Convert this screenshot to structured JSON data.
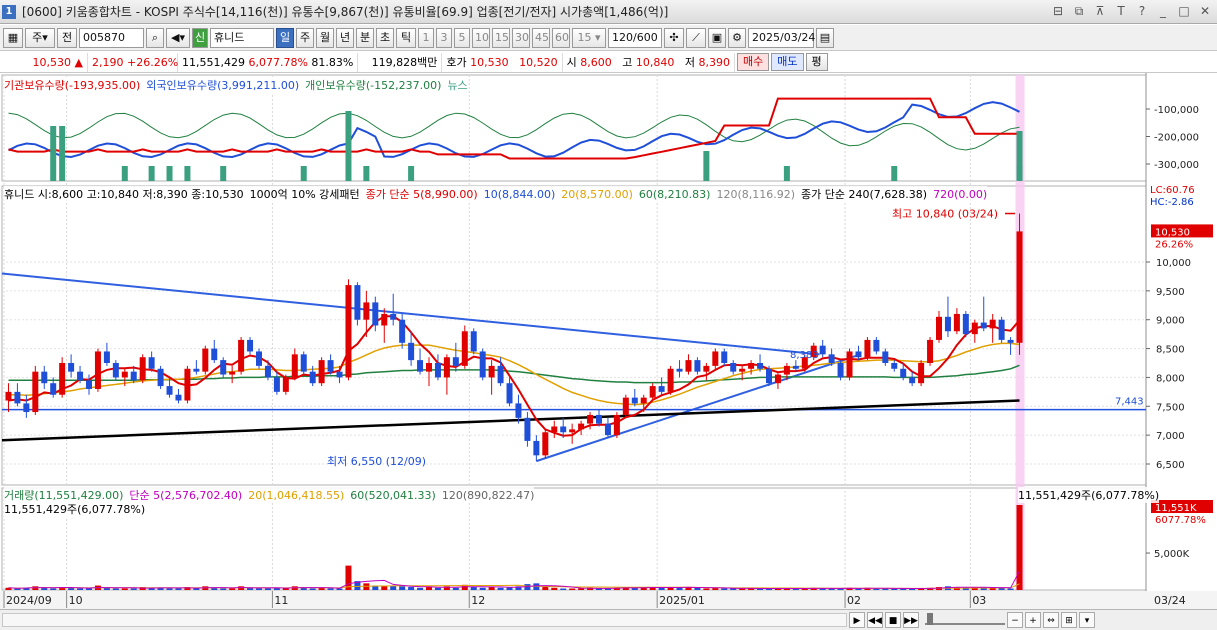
{
  "window": {
    "number": "1",
    "title": "[0600] 키움종합차트 - KOSPI 주식수[14,116(천)] 유통수[9,867(천)] 유통비율[69.9] 업종[전기/전자] 시가총액[1,486(억)]"
  },
  "toolbar": {
    "period_unit": "주",
    "prev_label": "전",
    "code": "005870",
    "stock_name": "휴니드",
    "stock_badge": "신",
    "periods": [
      "일",
      "주",
      "월",
      "년",
      "분",
      "초",
      "틱"
    ],
    "minutes": [
      "1",
      "3",
      "5",
      "10",
      "15",
      "30",
      "45",
      "60"
    ],
    "custom_min": "15",
    "count": "120",
    "count_max": "/600",
    "date": "2025/03/24"
  },
  "pricebar": {
    "price": "10,530",
    "arrow": "▲",
    "change": "2,190",
    "change_pct": "+26.26%",
    "volume": "11,551,429",
    "vol_ratio": "6,077.78%",
    "turnover": "81.83%",
    "amount": "119,828백만",
    "ask_label": "호가",
    "ask": "10,530",
    "bid": "10,520",
    "open_label": "시",
    "open": "8,600",
    "high_label": "고",
    "high": "10,840",
    "low_label": "저",
    "low": "8,390",
    "buy_label": "매수",
    "sell_label": "매도",
    "flat_label": "평"
  },
  "investor_panel": {
    "legend": [
      {
        "text": "기관보유수량(-193,935.00)",
        "color": "#e00000"
      },
      {
        "text": "외국인보유수량(3,991,211.00)",
        "color": "#1f4fd8"
      },
      {
        "text": "개인보유수량(-152,237.00)",
        "color": "#208040"
      },
      {
        "text": "뉴스",
        "color": "#3aa080"
      }
    ],
    "axis": [
      "-100,000",
      "-200,000",
      "-300,000"
    ]
  },
  "price_panel": {
    "legend_name": "휴니드 시:8,600 고:10,840 저:8,390 종:10,530",
    "legend_pattern": "1000억 10% 강세패턴",
    "ma_legend": [
      {
        "text": "종가 단순 5(8,990.00)",
        "color": "#e00000"
      },
      {
        "text": "10(8,844.00)",
        "color": "#1f4fd8"
      },
      {
        "text": "20(8,570.00)",
        "color": "#e0a000"
      },
      {
        "text": "60(8,210.83)",
        "color": "#208040"
      },
      {
        "text": "120(8,116.92)",
        "color": "#888888"
      },
      {
        "text": "종가 단순 240(7,628.38)",
        "color": "#000000"
      },
      {
        "text": "720(0.00)",
        "color": "#c000c0"
      }
    ],
    "lc": "LC:60.76",
    "hc": "HC:-2.86",
    "high_mark": "최고 10,840 (03/24)",
    "low_mark": "최저 6,550 (12/09)",
    "hline_label": "7,443",
    "trend_label": "8,388",
    "current_price": "10,530",
    "current_pct": "26.26%",
    "axis": [
      "10,000",
      "9,500",
      "9,000",
      "8,500",
      "8,000",
      "7,500",
      "7,000",
      "6,500"
    ]
  },
  "volume_panel": {
    "legend": [
      {
        "text": "거래량(11,551,429.00)",
        "color": "#208040"
      },
      {
        "text": "단순 5(2,576,702.40)",
        "color": "#c000c0"
      },
      {
        "text": "20(1,046,418.55)",
        "color": "#e0a000"
      },
      {
        "text": "60(520,041.33)",
        "color": "#208040"
      },
      {
        "text": "120(890,822.47)",
        "color": "#666666"
      }
    ],
    "sub_legend": "11,551,429주(6,077.78%)",
    "top_right": "11,551,429주(6,077.78%)",
    "current": "11,551K",
    "current_pct": "6077.78%",
    "axis": [
      "5,000K"
    ]
  },
  "xaxis": [
    "2024/09",
    "10",
    "11",
    "12",
    "2025/01",
    "02",
    "03"
  ],
  "last_date": "03/24",
  "colors": {
    "up": "#e00000",
    "down": "#1f4fd8",
    "highlight": "#f8c8f0"
  },
  "chart_data": {
    "type": "candlestick",
    "ylim": [
      6200,
      11000
    ],
    "candles": [
      [
        7600,
        7900,
        7400,
        7750
      ],
      [
        7750,
        7900,
        7500,
        7550
      ],
      [
        7550,
        7700,
        7300,
        7400
      ],
      [
        7400,
        8200,
        7350,
        8100
      ],
      [
        8100,
        8200,
        7800,
        7900
      ],
      [
        7900,
        8000,
        7650,
        7700
      ],
      [
        7700,
        8350,
        7650,
        8250
      ],
      [
        8250,
        8400,
        8000,
        8100
      ],
      [
        8100,
        8200,
        7900,
        7950
      ],
      [
        7950,
        8050,
        7700,
        7800
      ],
      [
        7800,
        8500,
        7750,
        8450
      ],
      [
        8450,
        8600,
        8200,
        8250
      ],
      [
        8250,
        8300,
        7950,
        8000
      ],
      [
        8000,
        8150,
        7850,
        8100
      ],
      [
        8100,
        8200,
        7900,
        7950
      ],
      [
        7950,
        8400,
        7900,
        8350
      ],
      [
        8350,
        8450,
        8100,
        8150
      ],
      [
        8150,
        8200,
        7800,
        7850
      ],
      [
        7850,
        8000,
        7650,
        7700
      ],
      [
        7700,
        7800,
        7550,
        7600
      ],
      [
        7600,
        8200,
        7550,
        8150
      ],
      [
        8150,
        8300,
        8050,
        8100
      ],
      [
        8100,
        8550,
        8050,
        8500
      ],
      [
        8500,
        8650,
        8250,
        8300
      ],
      [
        8300,
        8350,
        8000,
        8050
      ],
      [
        8050,
        8200,
        7900,
        8100
      ],
      [
        8100,
        8700,
        8050,
        8650
      ],
      [
        8650,
        8700,
        8400,
        8450
      ],
      [
        8450,
        8500,
        8150,
        8200
      ],
      [
        8200,
        8300,
        7950,
        8000
      ],
      [
        8000,
        8100,
        7700,
        7750
      ],
      [
        7750,
        8050,
        7700,
        8000
      ],
      [
        8000,
        8500,
        7950,
        8400
      ],
      [
        8400,
        8450,
        8050,
        8100
      ],
      [
        8100,
        8200,
        7850,
        7900
      ],
      [
        7900,
        8350,
        7850,
        8300
      ],
      [
        8300,
        8400,
        8050,
        8100
      ],
      [
        8100,
        8200,
        7900,
        8000
      ],
      [
        8000,
        9700,
        7950,
        9600
      ],
      [
        9600,
        9650,
        8900,
        9000
      ],
      [
        9000,
        9500,
        8700,
        9300
      ],
      [
        9300,
        9400,
        8800,
        8900
      ],
      [
        8900,
        9200,
        8600,
        9100
      ],
      [
        9100,
        9450,
        8900,
        9000
      ],
      [
        9000,
        9100,
        8500,
        8600
      ],
      [
        8600,
        8800,
        8200,
        8300
      ],
      [
        8300,
        8500,
        8050,
        8100
      ],
      [
        8100,
        8350,
        7850,
        8250
      ],
      [
        8250,
        8400,
        7950,
        8000
      ],
      [
        8000,
        8400,
        7700,
        8350
      ],
      [
        8350,
        8600,
        8100,
        8200
      ],
      [
        8200,
        8900,
        8150,
        8800
      ],
      [
        8800,
        8850,
        8400,
        8450
      ],
      [
        8450,
        8500,
        7950,
        8000
      ],
      [
        8000,
        8300,
        7700,
        8200
      ],
      [
        8200,
        8350,
        7850,
        7900
      ],
      [
        7900,
        8000,
        7500,
        7550
      ],
      [
        7550,
        7700,
        7200,
        7300
      ],
      [
        7300,
        7400,
        6800,
        6900
      ],
      [
        6900,
        7000,
        6550,
        6650
      ],
      [
        6650,
        7100,
        6600,
        7050
      ],
      [
        7050,
        7250,
        6950,
        7150
      ],
      [
        7150,
        7300,
        6950,
        7050
      ],
      [
        7050,
        7200,
        6850,
        7100
      ],
      [
        7100,
        7250,
        7000,
        7200
      ],
      [
        7200,
        7400,
        7100,
        7350
      ],
      [
        7350,
        7450,
        7150,
        7200
      ],
      [
        7200,
        7300,
        6950,
        7000
      ],
      [
        7000,
        7400,
        6950,
        7350
      ],
      [
        7350,
        7700,
        7300,
        7650
      ],
      [
        7650,
        7800,
        7500,
        7550
      ],
      [
        7550,
        7700,
        7400,
        7650
      ],
      [
        7650,
        7900,
        7600,
        7850
      ],
      [
        7850,
        8000,
        7700,
        7750
      ],
      [
        7750,
        8200,
        7700,
        8150
      ],
      [
        8150,
        8300,
        8000,
        8100
      ],
      [
        8100,
        8400,
        8050,
        8300
      ],
      [
        8300,
        8350,
        8050,
        8100
      ],
      [
        8100,
        8250,
        7950,
        8200
      ],
      [
        8200,
        8500,
        8150,
        8450
      ],
      [
        8450,
        8500,
        8200,
        8250
      ],
      [
        8250,
        8300,
        8050,
        8100
      ],
      [
        8100,
        8200,
        7950,
        8150
      ],
      [
        8150,
        8300,
        8050,
        8250
      ],
      [
        8250,
        8400,
        8100,
        8150
      ],
      [
        8150,
        8200,
        7850,
        7900
      ],
      [
        7900,
        8100,
        7800,
        8050
      ],
      [
        8050,
        8250,
        7950,
        8200
      ],
      [
        8200,
        8300,
        8100,
        8150
      ],
      [
        8150,
        8400,
        8100,
        8350
      ],
      [
        8350,
        8600,
        8300,
        8550
      ],
      [
        8550,
        8650,
        8350,
        8400
      ],
      [
        8400,
        8500,
        8200,
        8250
      ],
      [
        8250,
        8300,
        7950,
        8000
      ],
      [
        8000,
        8500,
        7950,
        8450
      ],
      [
        8450,
        8550,
        8300,
        8350
      ],
      [
        8350,
        8700,
        8300,
        8650
      ],
      [
        8650,
        8700,
        8400,
        8450
      ],
      [
        8450,
        8500,
        8200,
        8250
      ],
      [
        8250,
        8300,
        8100,
        8150
      ],
      [
        8150,
        8250,
        7950,
        8000
      ],
      [
        8000,
        8100,
        7850,
        7900
      ],
      [
        7900,
        8300,
        7850,
        8250
      ],
      [
        8250,
        8700,
        8200,
        8650
      ],
      [
        8650,
        9150,
        8600,
        9050
      ],
      [
        9050,
        9400,
        8700,
        8800
      ],
      [
        8800,
        9200,
        8750,
        9100
      ],
      [
        9100,
        9150,
        8700,
        8750
      ],
      [
        8750,
        9000,
        8600,
        8950
      ],
      [
        8950,
        9400,
        8800,
        8850
      ],
      [
        8850,
        9100,
        8600,
        9000
      ],
      [
        9000,
        9050,
        8600,
        8650
      ],
      [
        8650,
        8700,
        8390,
        8600
      ],
      [
        8600,
        10840,
        8390,
        10530
      ]
    ],
    "ma": {
      "5": [
        7600,
        7620,
        7600,
        7660,
        7740,
        7720,
        7800,
        7860,
        7970,
        7960,
        8060,
        8130,
        8160,
        8160,
        8170,
        8140,
        8130,
        8090,
        8000,
        7900,
        7860,
        7880,
        7990,
        8130,
        8240,
        8220,
        8320,
        8380,
        8350,
        8260,
        8090,
        7990,
        7980,
        8050,
        8030,
        8060,
        8080,
        8120,
        8460,
        8580,
        8780,
        8960,
        9060,
        9060,
        8960,
        8780,
        8580,
        8440,
        8250,
        8200,
        8180,
        8270,
        8360,
        8330,
        8330,
        8260,
        8030,
        7790,
        7530,
        7270,
        7100,
        7040,
        6990,
        7000,
        7110,
        7170,
        7180,
        7180,
        7220,
        7310,
        7350,
        7440,
        7610,
        7690,
        7740,
        7790,
        7880,
        8010,
        8040,
        8130,
        8210,
        8220,
        8210,
        8230,
        8210,
        8140,
        8090,
        8110,
        8110,
        8130,
        8250,
        8330,
        8350,
        8310,
        8320,
        8310,
        8340,
        8340,
        8340,
        8320,
        8240,
        8100,
        8020,
        8020,
        8160,
        8330,
        8560,
        8740,
        8850,
        8890,
        8890,
        8830,
        8810,
        8990
      ],
      "20": [
        7700,
        7700,
        7690,
        7700,
        7720,
        7730,
        7750,
        7770,
        7800,
        7820,
        7840,
        7860,
        7880,
        7900,
        7920,
        7940,
        7950,
        7960,
        7970,
        7970,
        7980,
        8000,
        8030,
        8060,
        8090,
        8100,
        8120,
        8140,
        8140,
        8140,
        8130,
        8120,
        8120,
        8130,
        8140,
        8150,
        8160,
        8180,
        8260,
        8320,
        8390,
        8460,
        8510,
        8540,
        8560,
        8560,
        8560,
        8560,
        8530,
        8500,
        8470,
        8450,
        8430,
        8400,
        8380,
        8350,
        8290,
        8220,
        8140,
        8050,
        7970,
        7890,
        7810,
        7740,
        7690,
        7640,
        7600,
        7570,
        7550,
        7540,
        7530,
        7540,
        7570,
        7610,
        7660,
        7710,
        7770,
        7830,
        7880,
        7930,
        7980,
        8030,
        8070,
        8110,
        8140,
        8150,
        8160,
        8170,
        8180,
        8200,
        8210,
        8230,
        8250,
        8260,
        8270,
        8280,
        8290,
        8300,
        8300,
        8300,
        8290,
        8280,
        8270,
        8270,
        8290,
        8330,
        8380,
        8440,
        8490,
        8540,
        8570,
        8590,
        8590,
        8570
      ],
      "60": [
        7950,
        7950,
        7950,
        7950,
        7950,
        7950,
        7950,
        7950,
        7950,
        7950,
        7950,
        7950,
        7950,
        7950,
        7950,
        7960,
        7960,
        7960,
        7960,
        7970,
        7970,
        7970,
        7980,
        7980,
        7990,
        7990,
        8000,
        8000,
        8000,
        8010,
        8010,
        8010,
        8020,
        8020,
        8020,
        8030,
        8030,
        8030,
        8050,
        8060,
        8080,
        8090,
        8100,
        8110,
        8120,
        8120,
        8130,
        8130,
        8130,
        8130,
        8130,
        8130,
        8130,
        8130,
        8130,
        8120,
        8110,
        8100,
        8080,
        8060,
        8040,
        8020,
        8000,
        7980,
        7970,
        7950,
        7940,
        7930,
        7920,
        7920,
        7910,
        7910,
        7910,
        7910,
        7910,
        7920,
        7920,
        7930,
        7940,
        7950,
        7960,
        7970,
        7980,
        7990,
        8000,
        8000,
        8010,
        8010,
        8010,
        8010,
        8010,
        8010,
        8010,
        8010,
        8010,
        8010,
        8010,
        8010,
        8010,
        8000,
        8000,
        8000,
        8000,
        8000,
        8010,
        8020,
        8030,
        8050,
        8060,
        8080,
        8100,
        8120,
        8150,
        8210
      ]
    },
    "ma240_start": 7050,
    "ma240_end": 7600,
    "volume": [
      0.3,
      0.2,
      0.3,
      0.5,
      0.3,
      0.2,
      0.4,
      0.3,
      0.2,
      0.2,
      0.6,
      0.3,
      0.2,
      0.2,
      0.2,
      0.4,
      0.3,
      0.3,
      0.2,
      0.2,
      0.4,
      0.2,
      0.5,
      0.3,
      0.2,
      0.2,
      0.5,
      0.3,
      0.2,
      0.2,
      0.3,
      0.3,
      0.5,
      0.3,
      0.2,
      0.3,
      0.2,
      0.2,
      3.3,
      1.2,
      0.9,
      0.6,
      0.5,
      0.6,
      0.5,
      0.4,
      0.3,
      0.4,
      0.3,
      0.5,
      0.3,
      0.7,
      0.4,
      0.3,
      0.4,
      0.3,
      0.4,
      0.5,
      0.8,
      0.9,
      0.4,
      0.3,
      0.2,
      0.2,
      0.2,
      0.3,
      0.2,
      0.2,
      0.3,
      0.4,
      0.3,
      0.3,
      0.4,
      0.3,
      0.4,
      0.3,
      0.4,
      0.3,
      0.2,
      0.3,
      0.2,
      0.2,
      0.2,
      0.2,
      0.2,
      0.2,
      0.2,
      0.2,
      0.2,
      0.2,
      0.3,
      0.2,
      0.2,
      0.2,
      0.3,
      0.2,
      0.3,
      0.2,
      0.2,
      0.2,
      0.2,
      0.2,
      0.2,
      0.3,
      0.4,
      0.5,
      0.4,
      0.3,
      0.3,
      0.4,
      0.3,
      0.3,
      0.2,
      11.5
    ]
  }
}
